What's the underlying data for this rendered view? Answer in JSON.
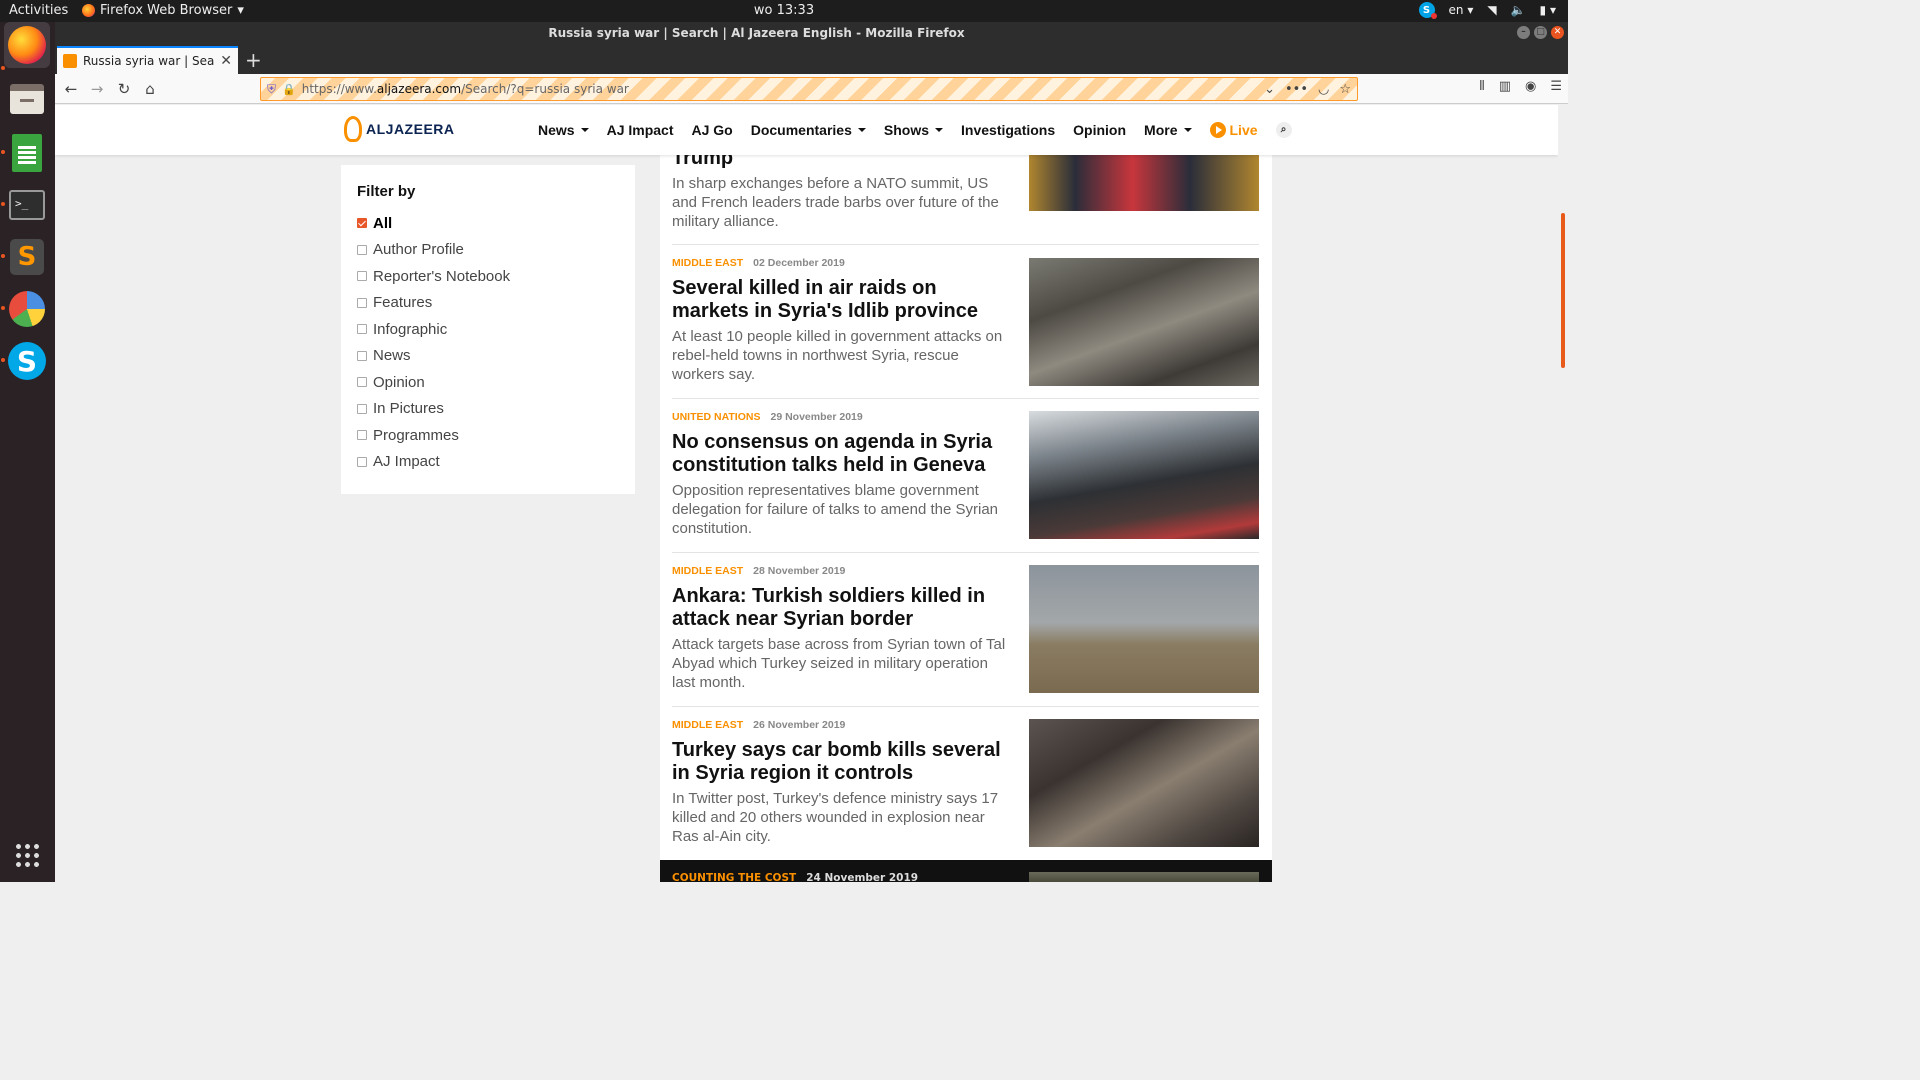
{
  "topbar": {
    "activities": "Activities",
    "app_menu": "Firefox Web Browser",
    "clock": "wo 13:33",
    "lang": "en"
  },
  "window": {
    "title": "Russia syria war | Search | Al Jazeera English - Mozilla Firefox"
  },
  "tab": {
    "title": "Russia syria war | Search"
  },
  "urlbar": {
    "prefix": "https://www.",
    "domain": "aljazeera.com",
    "path": "/Search/?q=russia syria war"
  },
  "site": {
    "logo": "ALJAZEERA",
    "nav": [
      "News",
      "AJ Impact",
      "AJ Go",
      "Documentaries",
      "Shows",
      "Investigations",
      "Opinion",
      "More"
    ],
    "live": "Live"
  },
  "filter": {
    "title": "Filter by",
    "options": [
      "All",
      "Author Profile",
      "Reporter's Notebook",
      "Features",
      "Infographic",
      "News",
      "Opinion",
      "In Pictures",
      "Programmes",
      "AJ Impact"
    ],
    "selected": "All"
  },
  "results": [
    {
      "category": "",
      "date": "",
      "headline": "Trump",
      "summary": "In sharp exchanges before a NATO summit, US and French leaders trade barbs over future of the military alliance."
    },
    {
      "category": "MIDDLE EAST",
      "date": "02 December 2019",
      "headline": "Several killed in air raids on markets in Syria's Idlib province",
      "summary": "At least 10 people killed in government attacks on rebel-held towns in northwest Syria, rescue workers say."
    },
    {
      "category": "UNITED NATIONS",
      "date": "29 November 2019",
      "headline": "No consensus on agenda in Syria constitution talks held in Geneva",
      "summary": "Opposition representatives blame government delegation for failure of talks to amend the Syrian constitution."
    },
    {
      "category": "MIDDLE EAST",
      "date": "28 November 2019",
      "headline": "Ankara: Turkish soldiers killed in attack near Syrian border",
      "summary": "Attack targets base across from Syrian town of Tal Abyad which Turkey seized in military operation last month."
    },
    {
      "category": "MIDDLE EAST",
      "date": "26 November 2019",
      "headline": "Turkey says car bomb kills several in Syria region it controls",
      "summary": "In Twitter post, Turkey's defence ministry says 17 killed and 20 others wounded in explosion near Ras al-Ain city."
    },
    {
      "category": "COUNTING THE COST",
      "date": "24 November 2019",
      "headline": "",
      "summary": ""
    }
  ]
}
